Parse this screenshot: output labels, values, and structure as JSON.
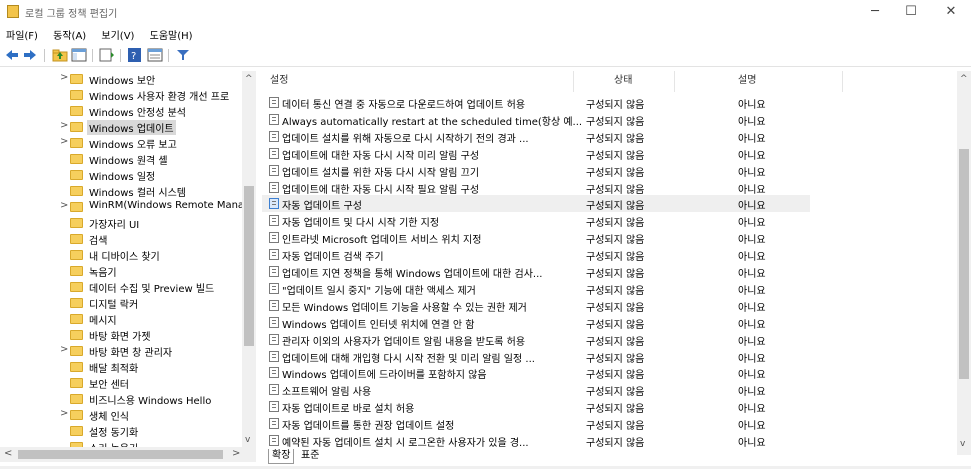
{
  "window": {
    "title": "로컬 그룹 정책 편집기",
    "minimize": "─",
    "maximize": "☐",
    "close": "✕"
  },
  "menu": [
    "파일(F)",
    "동작(A)",
    "보기(V)",
    "도움말(H)"
  ],
  "tree": [
    {
      "label": "Windows 보안",
      "chevron": ">"
    },
    {
      "label": "Windows 사용자 환경 개선 프로",
      "chevron": ""
    },
    {
      "label": "Windows 안정성 분석",
      "chevron": ""
    },
    {
      "label": "Windows 업데이트",
      "chevron": ">",
      "selected": true
    },
    {
      "label": "Windows 오류 보고",
      "chevron": ">"
    },
    {
      "label": "Windows 원격 셸",
      "chevron": ""
    },
    {
      "label": "Windows 일정",
      "chevron": ""
    },
    {
      "label": "Windows 컬러 시스템",
      "chevron": ""
    },
    {
      "label": "WinRM(Windows Remote Mana",
      "chevron": ">"
    },
    {
      "label": "가장자리 UI",
      "chevron": ""
    },
    {
      "label": "검색",
      "chevron": ""
    },
    {
      "label": "내 디바이스 찾기",
      "chevron": ""
    },
    {
      "label": "녹음기",
      "chevron": ""
    },
    {
      "label": "데이터 수집 및 Preview 빌드",
      "chevron": ""
    },
    {
      "label": "디지털 락커",
      "chevron": ""
    },
    {
      "label": "메시지",
      "chevron": ""
    },
    {
      "label": "바탕 화면 가젯",
      "chevron": ""
    },
    {
      "label": "바탕 화면 창 관리자",
      "chevron": ">"
    },
    {
      "label": "배달 최적화",
      "chevron": ""
    },
    {
      "label": "보안 센터",
      "chevron": ""
    },
    {
      "label": "비즈니스용 Windows Hello",
      "chevron": ""
    },
    {
      "label": "생체 인식",
      "chevron": ">"
    },
    {
      "label": "설정 동기화",
      "chevron": ""
    },
    {
      "label": "소리 녹음기",
      "chevron": ""
    }
  ],
  "columns": {
    "setting": "설정",
    "state": "상태",
    "comment": "설명"
  },
  "rows": [
    {
      "name": "데이터 통신 연결 중 자동으로 다운로드하여 업데이트 허용",
      "state": "구성되지 않음",
      "comment": "아니요"
    },
    {
      "name": "Always automatically restart at the scheduled time(항상 예...",
      "state": "구성되지 않음",
      "comment": "아니요"
    },
    {
      "name": "업데이트 설치를 위해 자동으로 다시 시작하기 전의 경과 ...",
      "state": "구성되지 않음",
      "comment": "아니요"
    },
    {
      "name": "업데이트에 대한 자동 다시 시작 미리 알림 구성",
      "state": "구성되지 않음",
      "comment": "아니요"
    },
    {
      "name": "업데이트 설치를 위한 자동 다시 시작 알림 끄기",
      "state": "구성되지 않음",
      "comment": "아니요"
    },
    {
      "name": "업데이트에 대한 자동 다시 시작 필요 알림 구성",
      "state": "구성되지 않음",
      "comment": "아니요"
    },
    {
      "name": "자동 업데이트 구성",
      "state": "구성되지 않음",
      "comment": "아니요",
      "selected": true
    },
    {
      "name": "자동 업데이트 및 다시 시작 기한 지정",
      "state": "구성되지 않음",
      "comment": "아니요"
    },
    {
      "name": "인트라넷 Microsoft 업데이트 서비스 위치 지정",
      "state": "구성되지 않음",
      "comment": "아니요"
    },
    {
      "name": "자동 업데이트 검색 주기",
      "state": "구성되지 않음",
      "comment": "아니요"
    },
    {
      "name": "업데이트 지연 정책을 통해 Windows 업데이트에 대한 검사...",
      "state": "구성되지 않음",
      "comment": "아니요"
    },
    {
      "name": "\"업데이트 일시 중지\" 기능에 대한 액세스 제거",
      "state": "구성되지 않음",
      "comment": "아니요"
    },
    {
      "name": "모든 Windows 업데이트 기능을 사용할 수 있는 권한 제거",
      "state": "구성되지 않음",
      "comment": "아니요"
    },
    {
      "name": "Windows 업데이트 인터넷 위치에 연결 안 함",
      "state": "구성되지 않음",
      "comment": "아니요"
    },
    {
      "name": "관리자 이외의 사용자가 업데이트 알림 내용을 받도록 허용",
      "state": "구성되지 않음",
      "comment": "아니요"
    },
    {
      "name": "업데이트에 대해 개입형 다시 시작 전환 및 미리 알림 일정 ...",
      "state": "구성되지 않음",
      "comment": "아니요"
    },
    {
      "name": "Windows 업데이트에 드라이버를 포함하지 않음",
      "state": "구성되지 않음",
      "comment": "아니요"
    },
    {
      "name": "소프트웨어 알림 사용",
      "state": "구성되지 않음",
      "comment": "아니요"
    },
    {
      "name": "자동 업데이트로 바로 설치 허용",
      "state": "구성되지 않음",
      "comment": "아니요"
    },
    {
      "name": "자동 업데이트를 통한 권장 업데이트 설정",
      "state": "구성되지 않음",
      "comment": "아니요"
    },
    {
      "name": "예약된 자동 업데이트 설치 시 로그온한 사용자가 있을 경...",
      "state": "구성되지 않음",
      "comment": "아니요"
    }
  ],
  "tabs": {
    "extended": "확장",
    "standard": "표준"
  },
  "scroll": {
    "up": "^",
    "down": "v",
    "left": "<",
    "right": ">"
  }
}
